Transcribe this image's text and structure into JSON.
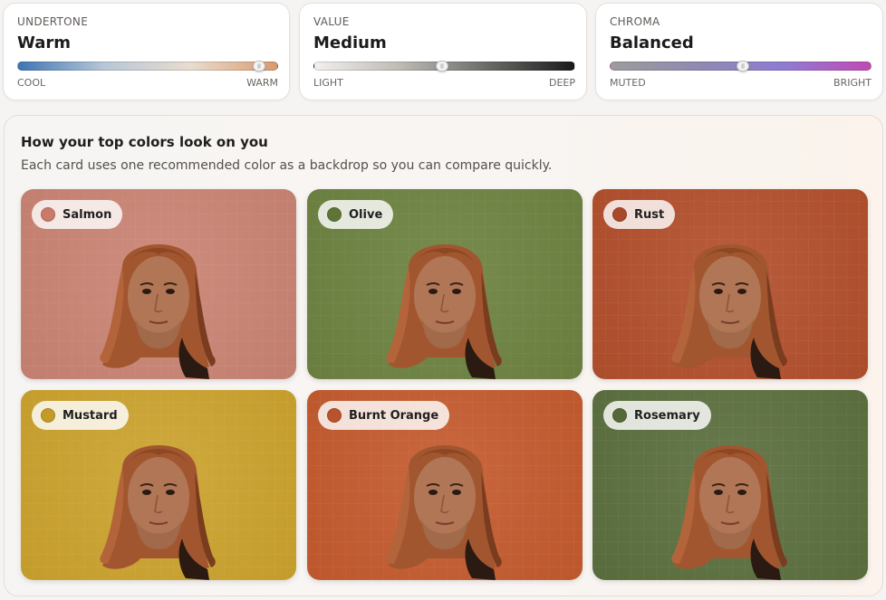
{
  "metrics": {
    "undertone": {
      "label": "UNDERTONE",
      "value": "Warm",
      "low": "COOL",
      "high": "WARM",
      "level": 0.93,
      "gradient": [
        "#3f75b3",
        "#b7c7d8",
        "#e8dccd",
        "#d99a6e"
      ]
    },
    "value": {
      "label": "VALUE",
      "value": "Medium",
      "low": "LIGHT",
      "high": "DEEP",
      "level": 0.49,
      "gradient": [
        "#f2f0ec",
        "#bdbab4",
        "#6a6a66",
        "#1a1a1a"
      ]
    },
    "chroma": {
      "label": "CHROMA",
      "value": "Balanced",
      "low": "MUTED",
      "high": "BRIGHT",
      "level": 0.51,
      "gradient": [
        "#9c9c9c",
        "#8f8ab0",
        "#8f7bd2",
        "#c14ab4"
      ]
    }
  },
  "panel": {
    "title": "How your top colors look on you",
    "subtitle": "Each card uses one recommended color as a backdrop so you can compare quickly."
  },
  "swatches": [
    {
      "name": "Salmon",
      "bg": "#c98373",
      "dot": "#c97a68"
    },
    {
      "name": "Olive",
      "bg": "#6c8240",
      "dot": "#5f7538"
    },
    {
      "name": "Rust",
      "bg": "#b24f2c",
      "dot": "#a9492a"
    },
    {
      "name": "Mustard",
      "bg": "#cba22d",
      "dot": "#c49a28"
    },
    {
      "name": "Burnt Orange",
      "bg": "#c45a2e",
      "dot": "#b9532b"
    },
    {
      "name": "Rosemary",
      "bg": "#5b6f3e",
      "dot": "#55683a"
    }
  ]
}
